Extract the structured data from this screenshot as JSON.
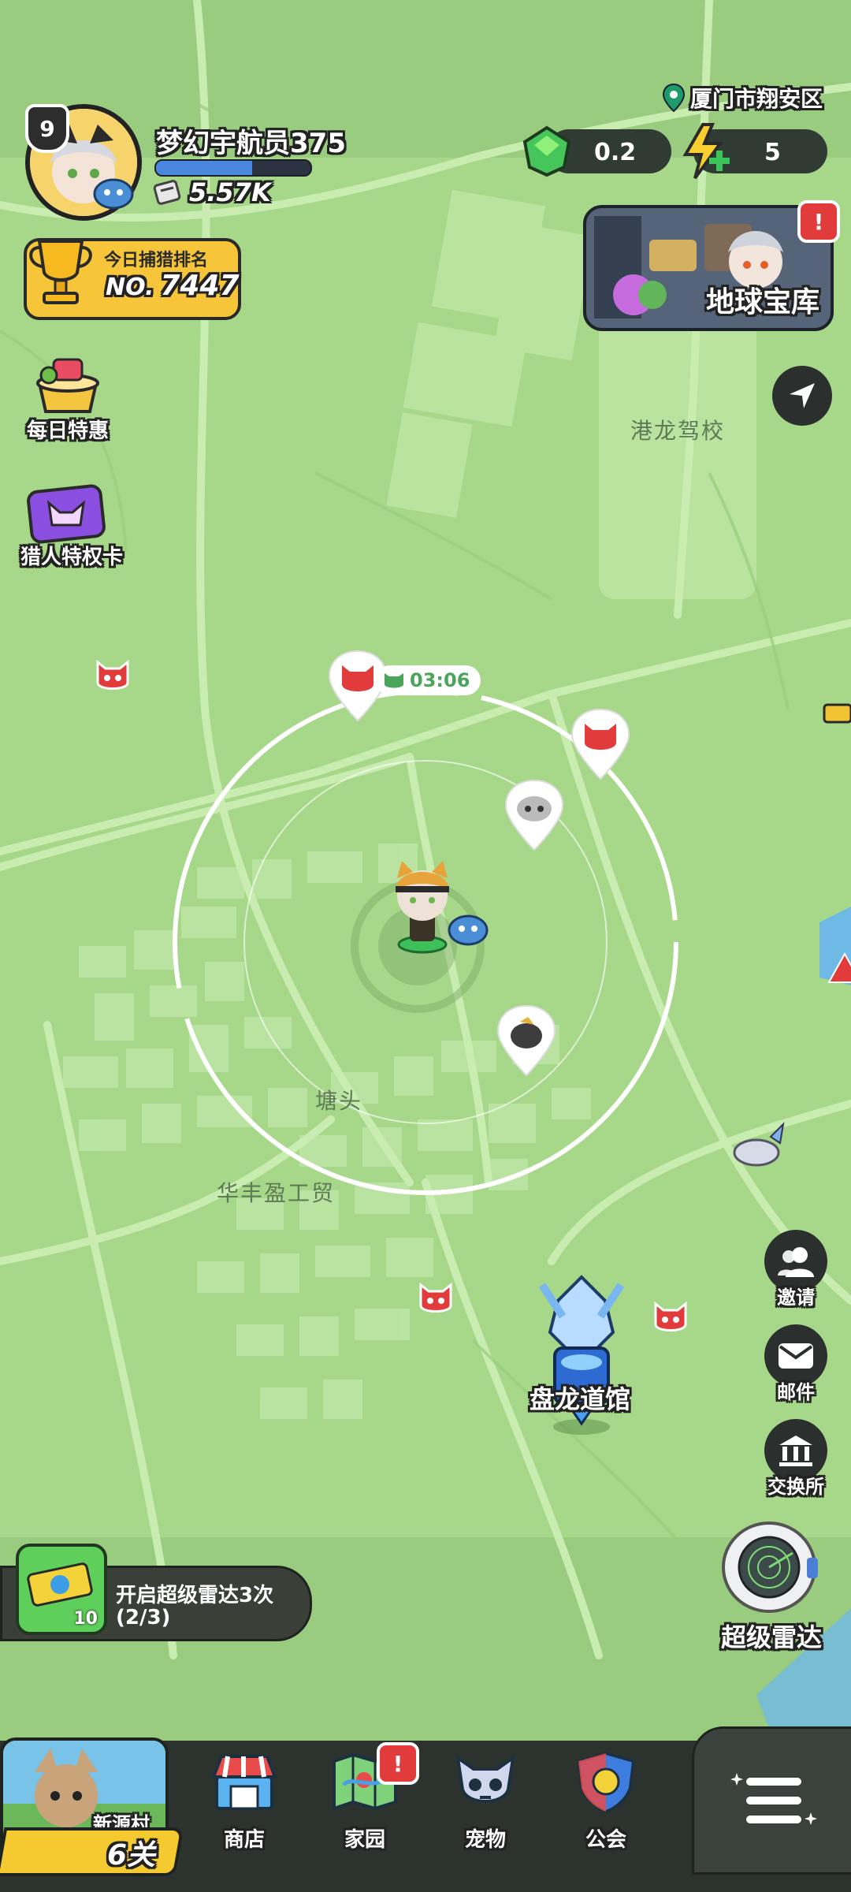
{
  "location": "厦门市翔安区",
  "player": {
    "level": "9",
    "name": "梦幻宇航员375",
    "power": "5.57K"
  },
  "currency": {
    "gems": "0.2",
    "energy": "5"
  },
  "rank": {
    "title": "今日捕猎排名",
    "prefix": "NO.",
    "value": "7447"
  },
  "treasury": {
    "label": "地球宝库",
    "alert": "!"
  },
  "left_menu": {
    "daily_deal": "每日特惠",
    "hunter_card": "猎人特权卡"
  },
  "map": {
    "timer": "03:06",
    "labels": {
      "school": "港龙驾校",
      "town": "塘头",
      "trade": "华丰盈工贸",
      "gym": "盘龙道馆"
    }
  },
  "right_menu": {
    "invite": "邀请",
    "mail": "邮件",
    "exchange": "交换所",
    "radar": "超级雷达"
  },
  "quest": {
    "badge": "10",
    "text_line1": "开启超级雷达3次",
    "text_line2": "(2/3)"
  },
  "bottom_nav": {
    "village": "新源村",
    "stage": "6关",
    "shop": "商店",
    "home": "家园",
    "home_alert": "!",
    "pets": "宠物",
    "guild": "公会"
  },
  "colors": {
    "map_bg": "#a9d98a",
    "road": "#c8ecb0",
    "accent_yellow": "#f7c53a",
    "dark_panel": "#2f3b33",
    "alert_red": "#e23b3b"
  }
}
